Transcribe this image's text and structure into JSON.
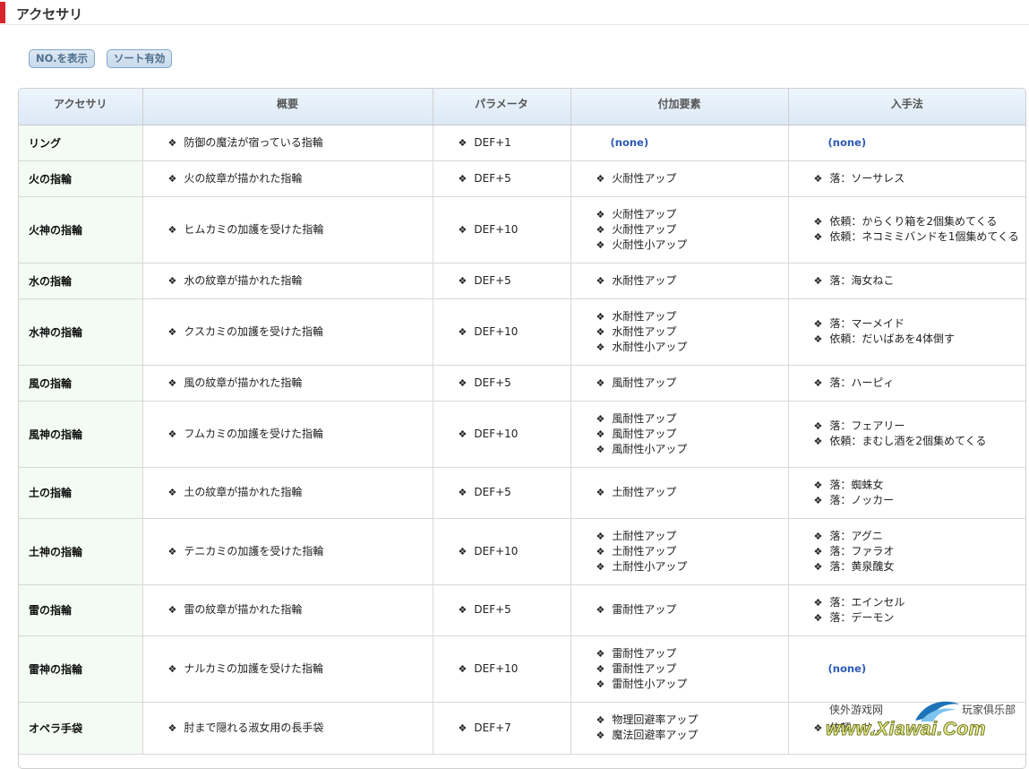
{
  "page": {
    "title": "アクセサリ"
  },
  "buttons": {
    "show_no": "NO.を表示",
    "sort": "ソート有効"
  },
  "table": {
    "headers": [
      "アクセサリ",
      "概要",
      "パラメータ",
      "付加要素",
      "入手法"
    ],
    "none_label": "(none)",
    "rows": [
      {
        "name": "リング",
        "summary": "防御の魔法が宿っている指輪",
        "param": "DEF+1",
        "extra": [],
        "obtain": []
      },
      {
        "name": "火の指輪",
        "summary": "火の紋章が描かれた指輪",
        "param": "DEF+5",
        "extra": [
          "火耐性アップ"
        ],
        "obtain": [
          "落：ソーサレス"
        ]
      },
      {
        "name": "火神の指輪",
        "summary": "ヒムカミの加護を受けた指輪",
        "param": "DEF+10",
        "extra": [
          "火耐性アップ",
          "火耐性アップ",
          "火耐性小アップ"
        ],
        "obtain": [
          "依頼：からくり箱を2個集めてくる",
          "依頼：ネコミミバンドを1個集めてくる"
        ]
      },
      {
        "name": "水の指輪",
        "summary": "水の紋章が描かれた指輪",
        "param": "DEF+5",
        "extra": [
          "水耐性アップ"
        ],
        "obtain": [
          "落：海女ねこ"
        ]
      },
      {
        "name": "水神の指輪",
        "summary": "クスカミの加護を受けた指輪",
        "param": "DEF+10",
        "extra": [
          "水耐性アップ",
          "水耐性アップ",
          "水耐性小アップ"
        ],
        "obtain": [
          "落：マーメイド",
          "依頼：だいばあを4体倒す"
        ]
      },
      {
        "name": "風の指輪",
        "summary": "風の紋章が描かれた指輪",
        "param": "DEF+5",
        "extra": [
          "風耐性アップ"
        ],
        "obtain": [
          "落：ハーピィ"
        ]
      },
      {
        "name": "風神の指輪",
        "summary": "フムカミの加護を受けた指輪",
        "param": "DEF+10",
        "extra": [
          "風耐性アップ",
          "風耐性アップ",
          "風耐性小アップ"
        ],
        "obtain": [
          "落：フェアリー",
          "依頼：まむし酒を2個集めてくる"
        ]
      },
      {
        "name": "土の指輪",
        "summary": "土の紋章が描かれた指輪",
        "param": "DEF+5",
        "extra": [
          "土耐性アップ"
        ],
        "obtain": [
          "落：蜘蛛女",
          "落：ノッカー"
        ]
      },
      {
        "name": "土神の指輪",
        "summary": "テニカミの加護を受けた指輪",
        "param": "DEF+10",
        "extra": [
          "土耐性アップ",
          "土耐性アップ",
          "土耐性小アップ"
        ],
        "obtain": [
          "落：アグニ",
          "落：ファラオ",
          "落：黄泉醜女"
        ]
      },
      {
        "name": "雷の指輪",
        "summary": "雷の紋章が描かれた指輪",
        "param": "DEF+5",
        "extra": [
          "雷耐性アップ"
        ],
        "obtain": [
          "落：エインセル",
          "落：デーモン"
        ]
      },
      {
        "name": "雷神の指輪",
        "summary": "ナルカミの加護を受けた指輪",
        "param": "DEF+10",
        "extra": [
          "雷耐性アップ",
          "雷耐性アップ",
          "雷耐性小アップ"
        ],
        "obtain": []
      },
      {
        "name": "オペラ手袋",
        "summary": "肘まで隠れる淑女用の長手袋",
        "param": "DEF+7",
        "extra": [
          "物理回避率アップ",
          "魔法回避率アップ"
        ],
        "obtain": [
          "依頼：サ..."
        ]
      }
    ]
  },
  "watermark": {
    "left_text": "侠外游戏网",
    "right_text": "玩家俱乐部",
    "url": "www.Xiawai.Com"
  }
}
